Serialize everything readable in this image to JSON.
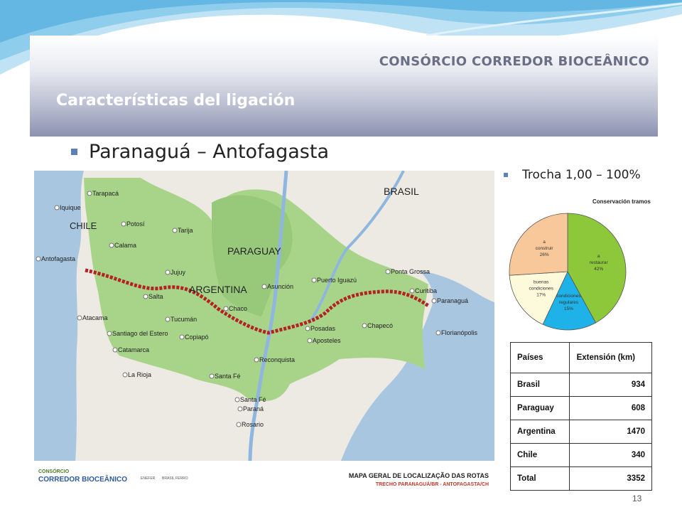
{
  "header": {
    "brand": "CONSÓRCIO CORREDOR BIOCEÂNICO",
    "title": "Características del ligación"
  },
  "bullets": {
    "main": "Paranaguá – Antofagasta",
    "gauge": "Trocha 1,00 – 100%"
  },
  "map": {
    "countries": [
      "CHILE",
      "PARAGUAY",
      "ARGENTINA",
      "BRASIL"
    ],
    "cities": [
      "Tarapacá",
      "Iquique",
      "Potosí",
      "Tarija",
      "Calama",
      "Antofagasta",
      "Jujuy",
      "Salta",
      "Asunción",
      "Puerto Iguazú",
      "Ponta Grossa",
      "Curitiba",
      "Paranaguá",
      "Chaco",
      "Tucumán",
      "Atacama",
      "Copiapó",
      "Santiago del Estero",
      "Posadas",
      "Chapecó",
      "Florianópolis",
      "Aposteles",
      "Catamarca",
      "La Rioja",
      "Reconquista",
      "Santa Fé",
      "Santa Fé",
      "Paraná",
      "Rosario"
    ],
    "footer_logo_small": "CONSÓRCIO",
    "footer_logo_big": "CORREDOR BIOCEÂNICO",
    "footer_partners": [
      "ENEFER",
      "BRASIL FERRO"
    ],
    "footer_title": "MAPA GERAL DE LOCALIZAÇÃO DAS ROTAS",
    "footer_subtitle": "TRECHO PARANAGUÁ/BR - ANTOFAGASTA/CH",
    "colors": {
      "land": "#eceae2",
      "green_zone": "#a8d48a",
      "water": "#a8c6e0",
      "route": "#b22222"
    }
  },
  "chart_data": {
    "type": "pie",
    "title": "Conservación tramos",
    "slices": [
      {
        "label": "a restaurar",
        "value": 42,
        "display": "42%",
        "color": "#8dc83a"
      },
      {
        "label": "condiciones regulares",
        "value": 15,
        "display": "15%",
        "color": "#1fb2e8"
      },
      {
        "label": "buenas condiciones",
        "value": 17,
        "display": "17%",
        "color": "#fdfadc"
      },
      {
        "label": "a construir",
        "value": 26,
        "display": "26%",
        "color": "#f9c89a"
      }
    ]
  },
  "table": {
    "headers": [
      "Países",
      "Extensión (km)"
    ],
    "rows": [
      [
        "Brasil",
        "934"
      ],
      [
        "Paraguay",
        "608"
      ],
      [
        "Argentina",
        "1470"
      ],
      [
        "Chile",
        "340"
      ],
      [
        "Total",
        "3352"
      ]
    ]
  },
  "page_number": "13"
}
